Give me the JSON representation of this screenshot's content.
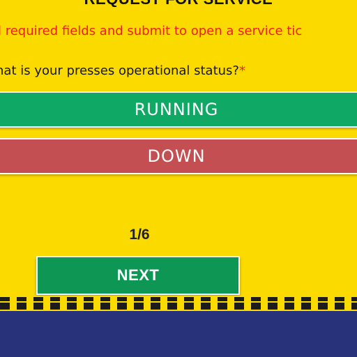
{
  "form": {
    "heading": "REQUEST FOR SERVICE",
    "instruction": "ll required fields and submit to open a service tic",
    "question": "hat is your presses operational status?",
    "required_mark": "*"
  },
  "options": {
    "running_label": "RUNNING",
    "down_label": "DOWN"
  },
  "pagination": {
    "indicator": "1/6",
    "next_label": "NEXT"
  },
  "colors": {
    "background": "#fbda00",
    "instruction_text": "#ee1c24",
    "running": "#10a865",
    "down": "#c44f52",
    "next": "#0e9655",
    "floor": "#28327a"
  }
}
